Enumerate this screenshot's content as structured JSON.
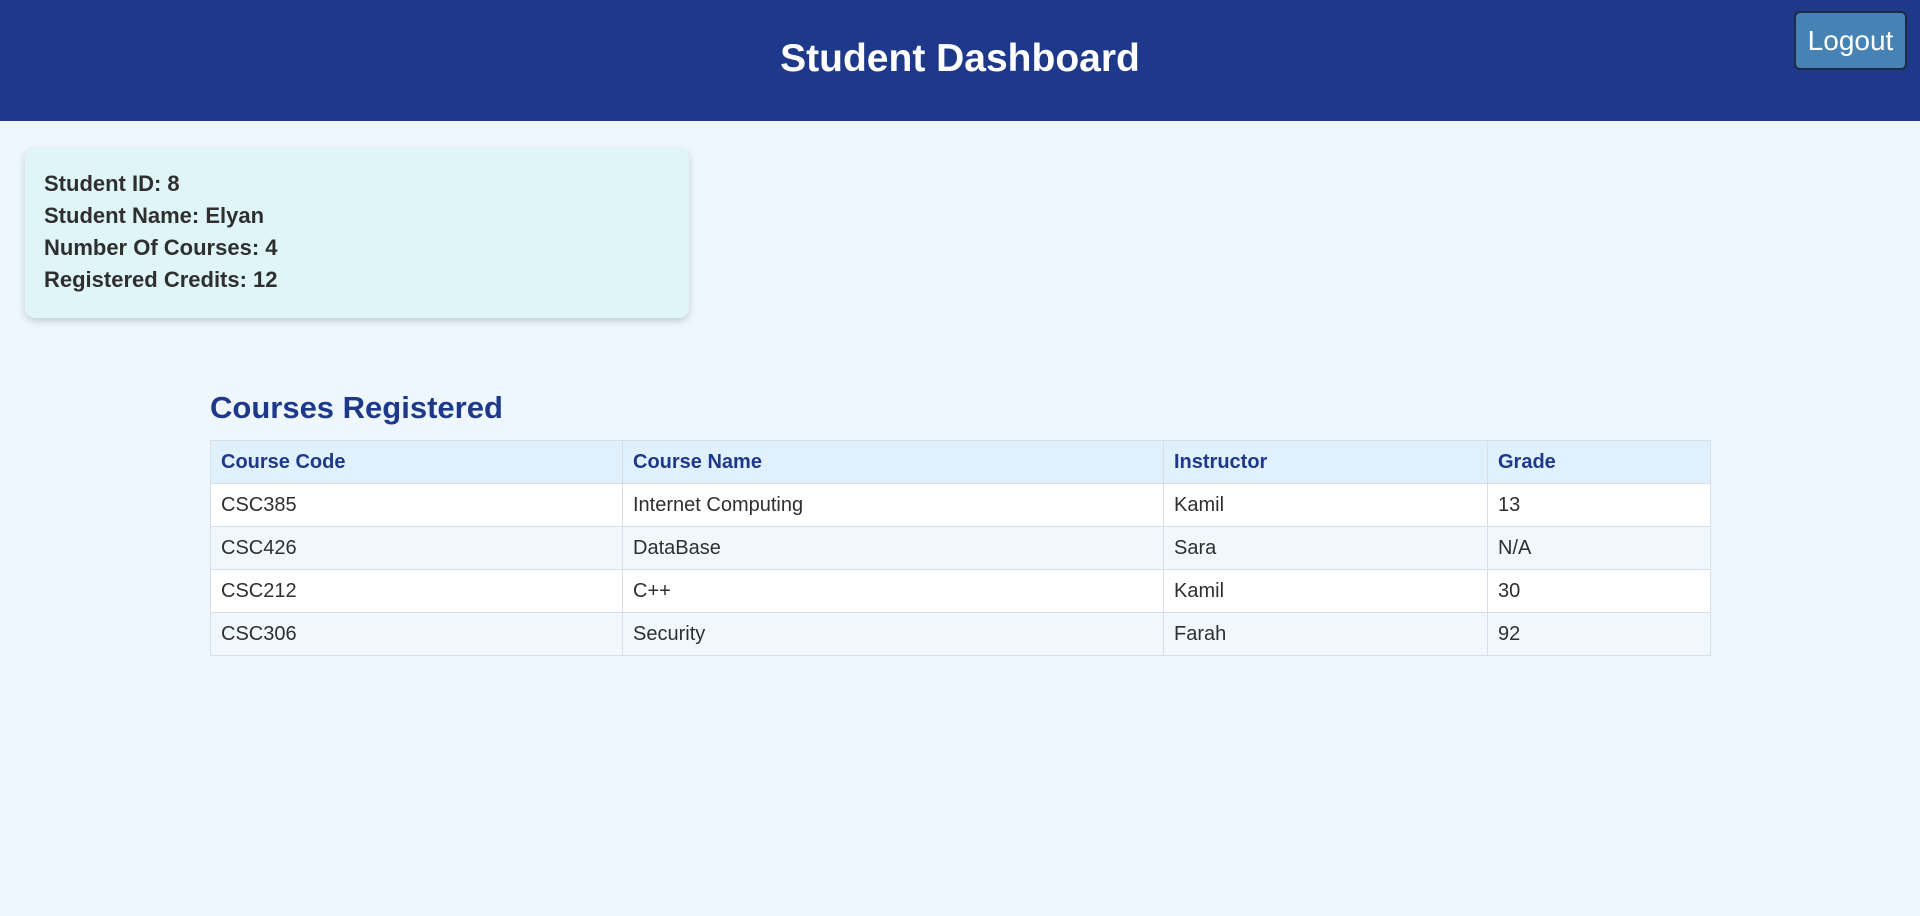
{
  "header": {
    "title": "Student Dashboard",
    "logout_label": "Logout"
  },
  "student_info": {
    "id_label": "Student ID: 8",
    "name_label": "Student Name: Elyan",
    "courses_label": "Number Of Courses: 4",
    "credits_label": "Registered Credits: 12"
  },
  "courses": {
    "title": "Courses Registered",
    "columns": [
      "Course Code",
      "Course Name",
      "Instructor",
      "Grade"
    ],
    "rows": [
      {
        "code": "CSC385",
        "name": "Internet Computing",
        "instructor": "Kamil",
        "grade": "13"
      },
      {
        "code": "CSC426",
        "name": "DataBase",
        "instructor": "Sara",
        "grade": "N/A"
      },
      {
        "code": "CSC212",
        "name": "C++",
        "instructor": "Kamil",
        "grade": "30"
      },
      {
        "code": "CSC306",
        "name": "Security",
        "instructor": "Farah",
        "grade": "92"
      }
    ]
  },
  "colors": {
    "header_bg": "#1e398a",
    "page_bg": "#eff7fe",
    "card_bg": "#dff5f8",
    "logout_bg": "#4682b4",
    "table_header_bg": "#e0f0fd",
    "accent_text": "#1e398a"
  }
}
